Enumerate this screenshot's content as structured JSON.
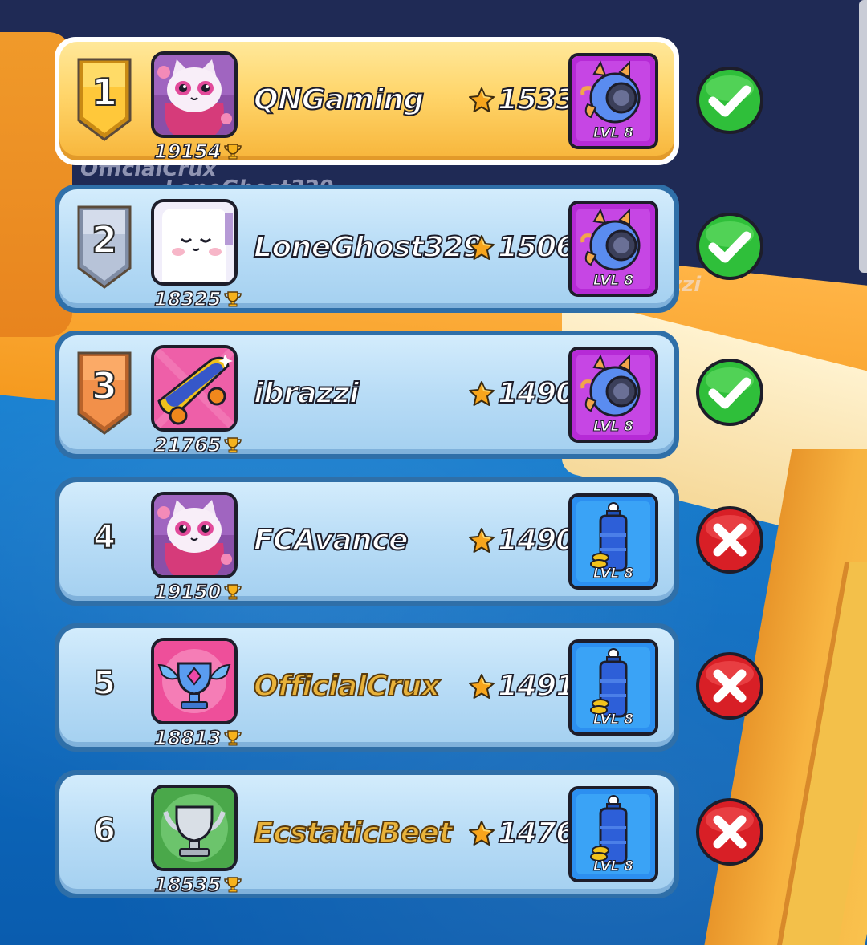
{
  "background": {
    "ghost_names": [
      "OfficialCrux",
      "LoneGhost329",
      "zzi"
    ]
  },
  "colors": {
    "first_row_gold": "#f7b53a",
    "row_blue": "#b8dcf6",
    "check_green": "#2fbf3a",
    "cross_red": "#d81f26",
    "item_purple": "#b62ad6",
    "item_blue": "#2c8ff0",
    "gold_name": "#e8b23a"
  },
  "leaderboard": {
    "rows": [
      {
        "rank": "1",
        "name": "QNGaming",
        "trophies": "19154",
        "score": "1533",
        "item_level": "LVL 8",
        "item_icon": "rocket-ball-icon",
        "avatar_icon": "pink-cat-avatar-icon",
        "result": "check",
        "rank_style": "gold-shield",
        "name_style": "white"
      },
      {
        "rank": "2",
        "name": "LoneGhost329",
        "trophies": "18325",
        "score": "1506",
        "item_level": "LVL 8",
        "item_icon": "rocket-ball-icon",
        "avatar_icon": "sleepy-ghost-avatar-icon",
        "result": "check",
        "rank_style": "silver-shield",
        "name_style": "white"
      },
      {
        "rank": "3",
        "name": "ibrazzi",
        "trophies": "21765",
        "score": "1490",
        "item_level": "LVL 8",
        "item_icon": "rocket-ball-icon",
        "avatar_icon": "skateboard-avatar-icon",
        "result": "check",
        "rank_style": "bronze-shield",
        "name_style": "white"
      },
      {
        "rank": "4",
        "name": "FCAvance",
        "trophies": "19150",
        "score": "1490",
        "item_level": "LVL 8",
        "item_icon": "water-bottle-icon",
        "avatar_icon": "pink-cat-avatar-icon",
        "result": "cross",
        "rank_style": "plain",
        "name_style": "white"
      },
      {
        "rank": "5",
        "name": "OfficialCrux",
        "trophies": "18813",
        "score": "1491",
        "item_level": "LVL 8",
        "item_icon": "water-bottle-icon",
        "avatar_icon": "winged-trophy-avatar-icon",
        "result": "cross",
        "rank_style": "plain",
        "name_style": "gold"
      },
      {
        "rank": "6",
        "name": "EcstaticBeet",
        "trophies": "18535",
        "score": "1476",
        "item_level": "LVL 8",
        "item_icon": "water-bottle-icon",
        "avatar_icon": "silver-trophy-avatar-icon",
        "result": "cross",
        "rank_style": "plain",
        "name_style": "gold"
      }
    ]
  }
}
